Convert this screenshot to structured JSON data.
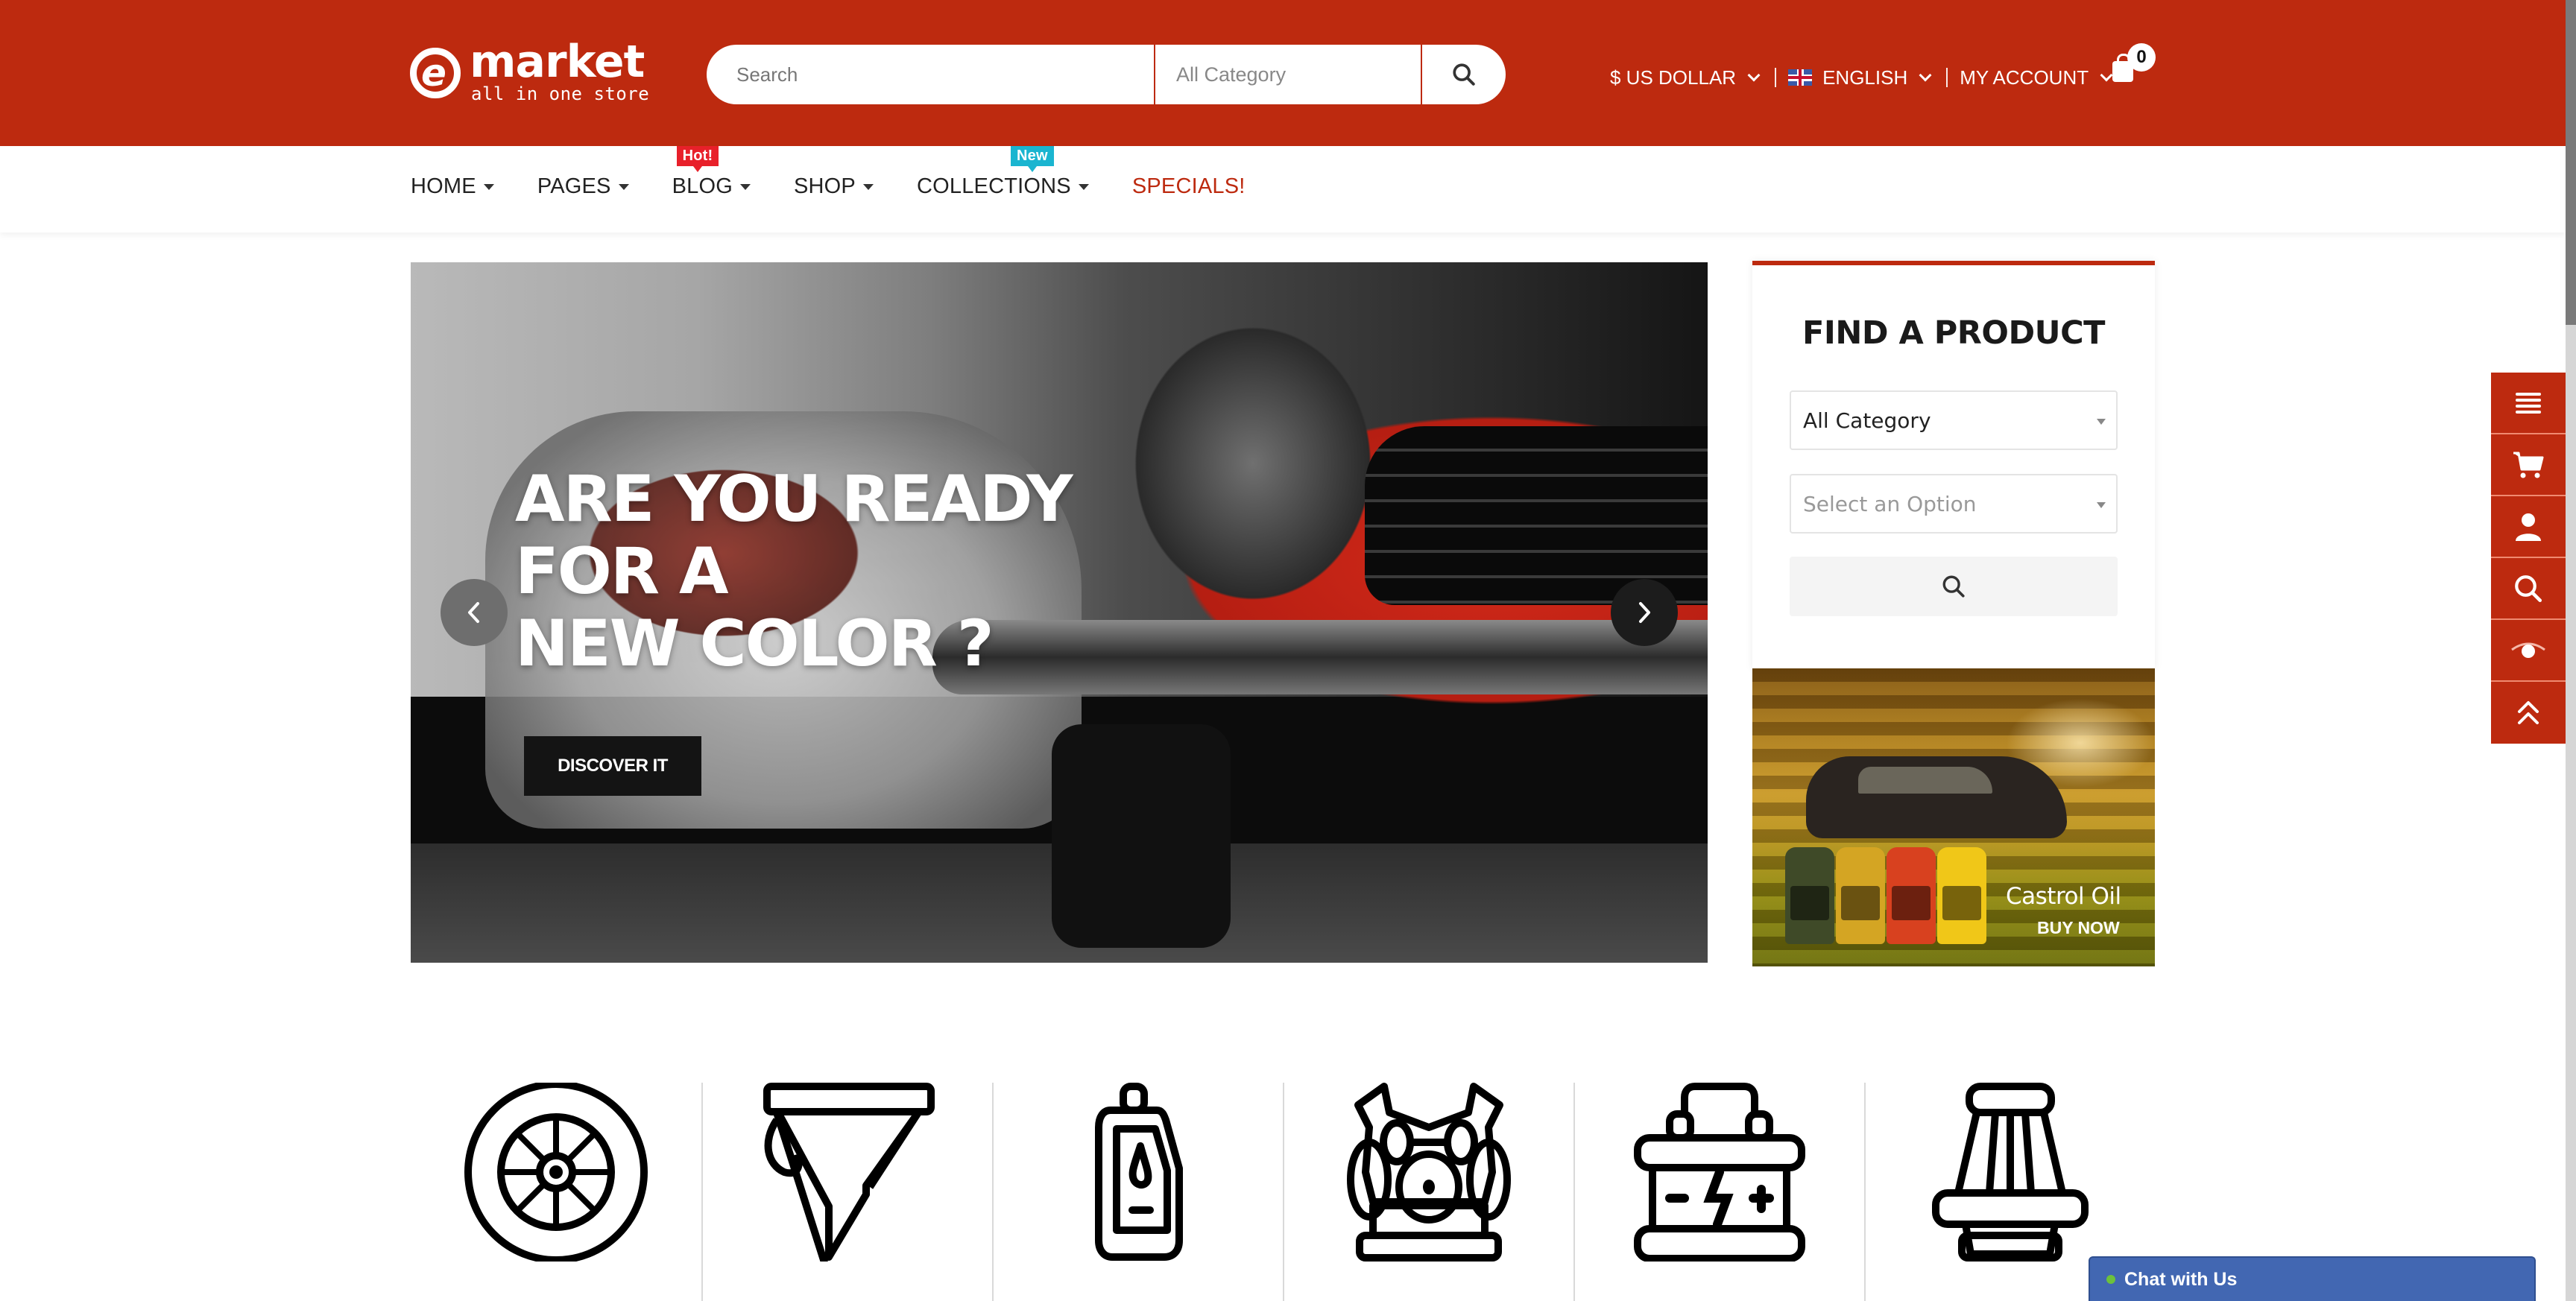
{
  "header": {
    "logo": {
      "mark": "e",
      "brand": "market",
      "tagline": "all in one store"
    },
    "search": {
      "placeholder": "Search",
      "category": "All Category"
    },
    "currency": "$ US DOLLAR",
    "language": "ENGLISH",
    "account": "MY ACCOUNT",
    "cart_count": "0"
  },
  "nav": {
    "items": [
      {
        "label": "HOME",
        "dropdown": true
      },
      {
        "label": "PAGES",
        "dropdown": true
      },
      {
        "label": "BLOG",
        "dropdown": true,
        "badge": "Hot!",
        "badge_color": "#e8202a"
      },
      {
        "label": "SHOP",
        "dropdown": true
      },
      {
        "label": "COLLECTIONS",
        "dropdown": true,
        "badge": "New",
        "badge_color": "#1ab5d0"
      },
      {
        "label": "SPECIALS!",
        "dropdown": false,
        "highlight": "#bd2a0f"
      }
    ]
  },
  "slider": {
    "title": "ARE YOU READY\nFOR A\nNEW COLOR ?",
    "button": "DISCOVER IT"
  },
  "find_product": {
    "title": "FIND A PRODUCT",
    "category_select": "All Category",
    "option_select_placeholder": "Select an Option"
  },
  "banner": {
    "title": "Castrol Oil",
    "cta": "BUY NOW"
  },
  "side_tools": [
    "menu-icon",
    "cart-icon",
    "user-icon",
    "search-icon",
    "eye-icon",
    "scroll-top-icon"
  ],
  "categories": [
    "wheel-icon",
    "funnel-filter-icon",
    "oil-can-icon",
    "engine-icon",
    "battery-icon",
    "air-filter-icon"
  ],
  "chat": {
    "label": "Chat with Us",
    "status_color": "#6cc13c"
  },
  "colors": {
    "brand": "#bd2a0f",
    "chat": "#4267b2"
  }
}
